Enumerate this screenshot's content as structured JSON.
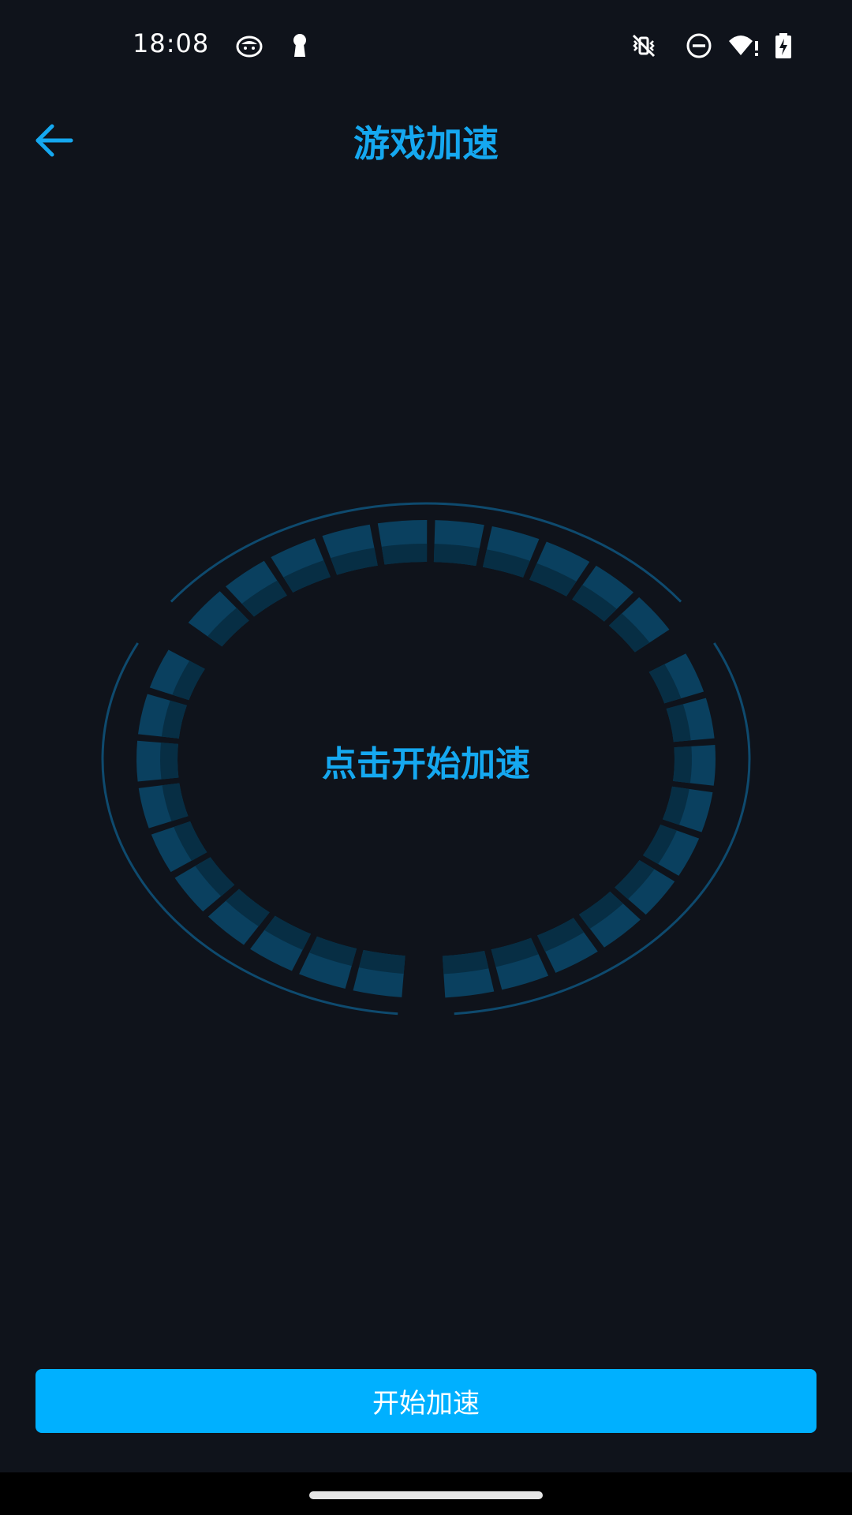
{
  "status_bar": {
    "time": "18:08",
    "left_icons": [
      "cat-face-icon",
      "keyhole-icon"
    ],
    "right_icons": [
      "vibrate-off-icon",
      "do-not-disturb-icon",
      "wifi-alert-icon",
      "battery-charging-icon"
    ]
  },
  "app_bar": {
    "back_icon": "arrow-left-icon",
    "title": "游戏加速"
  },
  "ring": {
    "center_text": "点击开始加速"
  },
  "start_button": {
    "label": "开始加速"
  },
  "colors": {
    "background": "#0f131b",
    "accent": "#15a8f0",
    "button": "#00b0ff",
    "segment": "#0a405f",
    "segment_inner": "#072e44",
    "outer_arc": "#0e4a6e"
  }
}
